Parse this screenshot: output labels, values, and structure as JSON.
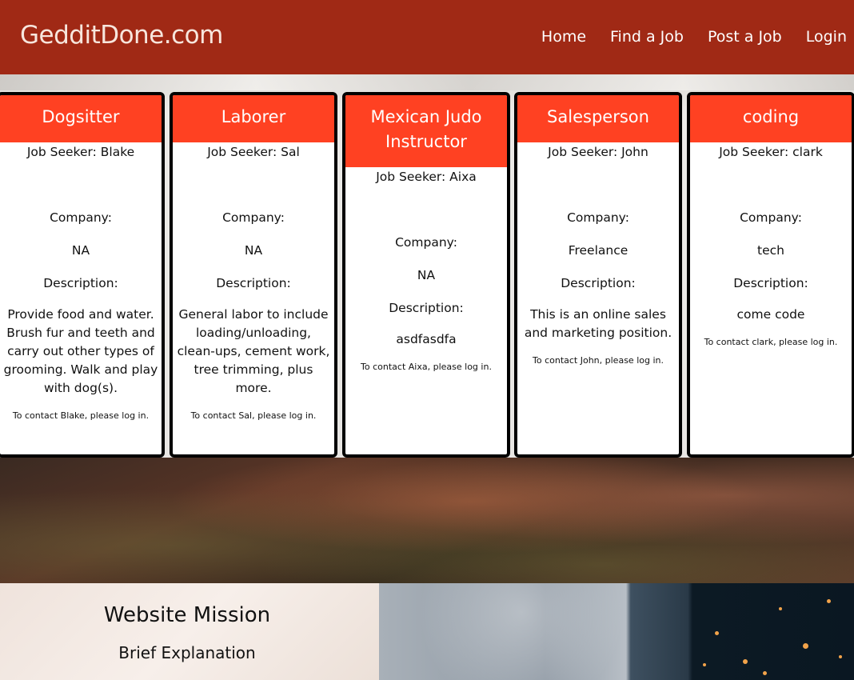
{
  "header": {
    "logo": "GedditDone.com",
    "nav": [
      "Home",
      "Find a Job",
      "Post a Job",
      "Login"
    ]
  },
  "cards": [
    {
      "title": "Dogsitter",
      "seeker": "Job Seeker: Blake",
      "company_label": "Company:",
      "company": "NA",
      "description_label": "Description:",
      "description": "Provide food and water. Brush fur and teeth and carry out other types of grooming. Walk and play with dog(s).",
      "contact": "To contact Blake, please log in."
    },
    {
      "title": "Laborer",
      "seeker": "Job Seeker: Sal",
      "company_label": "Company:",
      "company": "NA",
      "description_label": "Description:",
      "description": "General labor to include loading/unloading, clean-ups, cement work, tree trimming, plus more.",
      "contact": "To contact Sal, please log in."
    },
    {
      "title": "Mexican Judo Instructor",
      "seeker": "Job Seeker: Aixa",
      "company_label": "Company:",
      "company": "NA",
      "description_label": "Description:",
      "description": "asdfasdfa",
      "contact": "To contact Aixa, please log in."
    },
    {
      "title": "Salesperson",
      "seeker": "Job Seeker: John",
      "company_label": "Company:",
      "company": "Freelance",
      "description_label": "Description:",
      "description": "This is an online sales and marketing position.",
      "contact": "To contact John, please log in."
    },
    {
      "title": "coding",
      "seeker": "Job Seeker: clark",
      "company_label": "Company:",
      "company": "tech",
      "description_label": "Description:",
      "description": "come code",
      "contact": "To contact clark, please log in."
    }
  ],
  "mission": {
    "title": "Website Mission",
    "subtitle": "Brief Explanation"
  },
  "colors": {
    "header_bg": "#a02915",
    "card_title_bg": "#ff4122"
  }
}
